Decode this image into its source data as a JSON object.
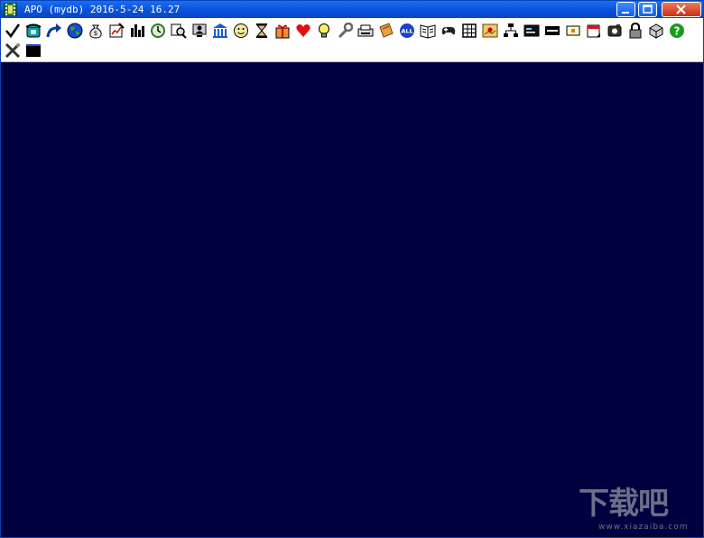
{
  "window": {
    "title": "APO (mydb) 2016-5-24 16.27",
    "icon": "app-film-icon",
    "colors": {
      "titlebar": "#0a52d8",
      "workspace": "#000040",
      "toolbar": "#ffffff"
    }
  },
  "title_buttons": [
    {
      "name": "minimize-button",
      "icon": "minimize-icon"
    },
    {
      "name": "maximize-button",
      "icon": "maximize-icon"
    },
    {
      "name": "close-button",
      "icon": "close-icon"
    }
  ],
  "toolbar": {
    "rows": [
      [
        "check",
        "telephone",
        "redo-arrow",
        "globe",
        "money-bag",
        "chart-edit",
        "bar-chart",
        "clock-refresh",
        "find-record",
        "person-monitor",
        "bank",
        "smiley",
        "hourglass",
        "gift",
        "heart",
        "lightbulb",
        "wrench",
        "printer-card",
        "sticky-note",
        "all-badge",
        "open-book",
        "gamepad",
        "grid-table",
        "map-pin",
        "org-chart",
        "card-reader",
        "id-card",
        "mail-label",
        "calendar",
        "camera",
        "lock",
        "package-box",
        "help"
      ],
      [
        "tools",
        "terminal"
      ]
    ],
    "all_badge_text": "ALL"
  },
  "watermark": {
    "main": "下载吧",
    "sub": "www.xiazaiba.com"
  }
}
